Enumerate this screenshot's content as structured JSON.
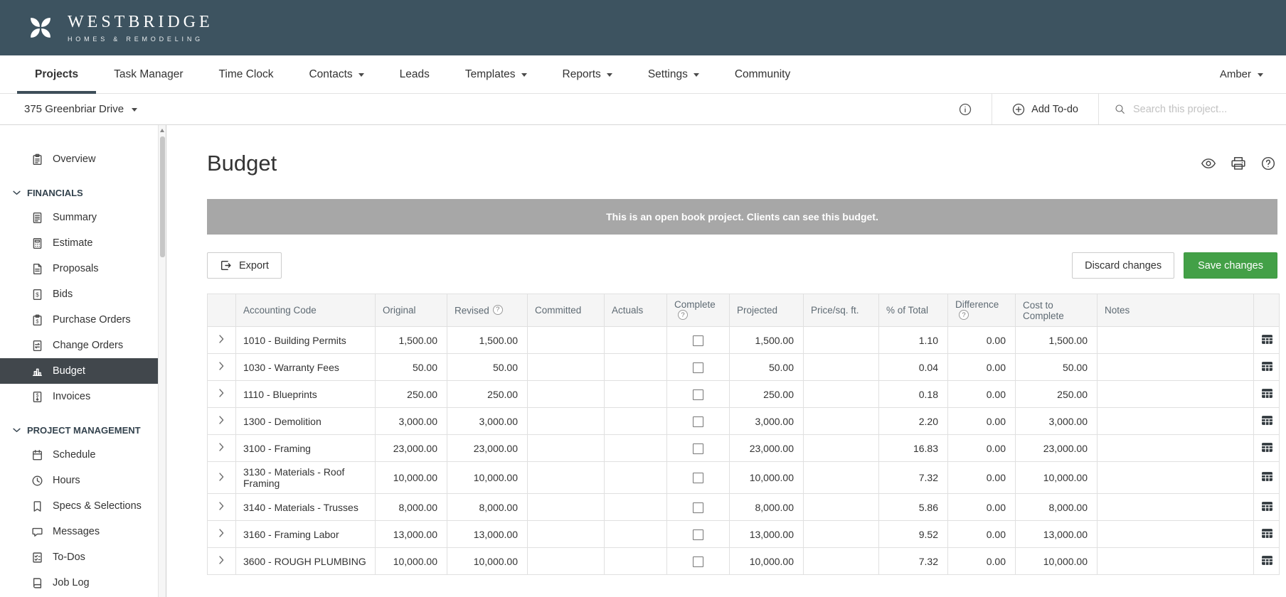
{
  "colors": {
    "header_slate": "#3d5360",
    "banner_gray": "#a7a7a7",
    "active_sidebar_dark": "#41474c",
    "save_green": "#43a047"
  },
  "brand": {
    "name": "WESTBRIDGE",
    "tagline": "HOMES & REMODELING"
  },
  "nav": {
    "items": [
      {
        "label": "Projects",
        "active": true
      },
      {
        "label": "Task Manager"
      },
      {
        "label": "Time Clock"
      },
      {
        "label": "Contacts",
        "dropdown": true
      },
      {
        "label": "Leads"
      },
      {
        "label": "Templates",
        "dropdown": true
      },
      {
        "label": "Reports",
        "dropdown": true
      },
      {
        "label": "Settings",
        "dropdown": true
      },
      {
        "label": "Community"
      }
    ],
    "user": "Amber"
  },
  "project_bar": {
    "project_name": "375 Greenbriar Drive",
    "add_todo_label": "Add To-do",
    "search_placeholder": "Search this project..."
  },
  "sidebar": {
    "overview": {
      "label": "Overview",
      "icon": "clipboard-icon"
    },
    "active": "Budget",
    "sections": [
      {
        "label": "FINANCIALS",
        "items": [
          {
            "label": "Summary",
            "icon": "summary-icon"
          },
          {
            "label": "Estimate",
            "icon": "estimate-icon"
          },
          {
            "label": "Proposals",
            "icon": "proposals-icon"
          },
          {
            "label": "Bids",
            "icon": "bids-icon"
          },
          {
            "label": "Purchase Orders",
            "icon": "purchase-orders-icon"
          },
          {
            "label": "Change Orders",
            "icon": "change-orders-icon"
          },
          {
            "label": "Budget",
            "icon": "budget-icon"
          },
          {
            "label": "Invoices",
            "icon": "invoices-icon"
          }
        ]
      },
      {
        "label": "PROJECT MANAGEMENT",
        "items": [
          {
            "label": "Schedule",
            "icon": "calendar-icon"
          },
          {
            "label": "Hours",
            "icon": "clock-icon"
          },
          {
            "label": "Specs & Selections",
            "icon": "specs-icon"
          },
          {
            "label": "Messages",
            "icon": "messages-icon"
          },
          {
            "label": "To-Dos",
            "icon": "todos-icon"
          },
          {
            "label": "Job Log",
            "icon": "job-log-icon"
          }
        ]
      }
    ]
  },
  "page": {
    "title": "Budget",
    "banner": "This is an open book project. Clients can see this budget.",
    "export_label": "Export",
    "discard_label": "Discard changes",
    "save_label": "Save changes"
  },
  "table": {
    "columns": [
      "Accounting Code",
      "Original",
      "Revised",
      "Committed",
      "Actuals",
      "Complete",
      "Projected",
      "Price/sq. ft.",
      "% of Total",
      "Difference",
      "Cost to Complete",
      "Notes"
    ],
    "rows": [
      {
        "code": "1010 - Building Permits",
        "original": "1,500.00",
        "revised": "1,500.00",
        "committed": "",
        "actuals": "",
        "complete": false,
        "projected": "1,500.00",
        "price_sqft": "",
        "pct_total": "1.10",
        "difference": "0.00",
        "cost_to_complete": "1,500.00",
        "notes": ""
      },
      {
        "code": "1030 - Warranty Fees",
        "original": "50.00",
        "revised": "50.00",
        "committed": "",
        "actuals": "",
        "complete": false,
        "projected": "50.00",
        "price_sqft": "",
        "pct_total": "0.04",
        "difference": "0.00",
        "cost_to_complete": "50.00",
        "notes": ""
      },
      {
        "code": "1110 - Blueprints",
        "original": "250.00",
        "revised": "250.00",
        "committed": "",
        "actuals": "",
        "complete": false,
        "projected": "250.00",
        "price_sqft": "",
        "pct_total": "0.18",
        "difference": "0.00",
        "cost_to_complete": "250.00",
        "notes": ""
      },
      {
        "code": "1300 - Demolition",
        "original": "3,000.00",
        "revised": "3,000.00",
        "committed": "",
        "actuals": "",
        "complete": false,
        "projected": "3,000.00",
        "price_sqft": "",
        "pct_total": "2.20",
        "difference": "0.00",
        "cost_to_complete": "3,000.00",
        "notes": ""
      },
      {
        "code": "3100 - Framing",
        "original": "23,000.00",
        "revised": "23,000.00",
        "committed": "",
        "actuals": "",
        "complete": false,
        "projected": "23,000.00",
        "price_sqft": "",
        "pct_total": "16.83",
        "difference": "0.00",
        "cost_to_complete": "23,000.00",
        "notes": ""
      },
      {
        "code": "3130 - Materials - Roof Framing",
        "original": "10,000.00",
        "revised": "10,000.00",
        "committed": "",
        "actuals": "",
        "complete": false,
        "projected": "10,000.00",
        "price_sqft": "",
        "pct_total": "7.32",
        "difference": "0.00",
        "cost_to_complete": "10,000.00",
        "notes": ""
      },
      {
        "code": "3140 - Materials - Trusses",
        "original": "8,000.00",
        "revised": "8,000.00",
        "committed": "",
        "actuals": "",
        "complete": false,
        "projected": "8,000.00",
        "price_sqft": "",
        "pct_total": "5.86",
        "difference": "0.00",
        "cost_to_complete": "8,000.00",
        "notes": ""
      },
      {
        "code": "3160 - Framing Labor",
        "original": "13,000.00",
        "revised": "13,000.00",
        "committed": "",
        "actuals": "",
        "complete": false,
        "projected": "13,000.00",
        "price_sqft": "",
        "pct_total": "9.52",
        "difference": "0.00",
        "cost_to_complete": "13,000.00",
        "notes": ""
      },
      {
        "code": "3600 - ROUGH PLUMBING",
        "original": "10,000.00",
        "revised": "10,000.00",
        "committed": "",
        "actuals": "",
        "complete": false,
        "projected": "10,000.00",
        "price_sqft": "",
        "pct_total": "7.32",
        "difference": "0.00",
        "cost_to_complete": "10,000.00",
        "notes": ""
      }
    ]
  }
}
